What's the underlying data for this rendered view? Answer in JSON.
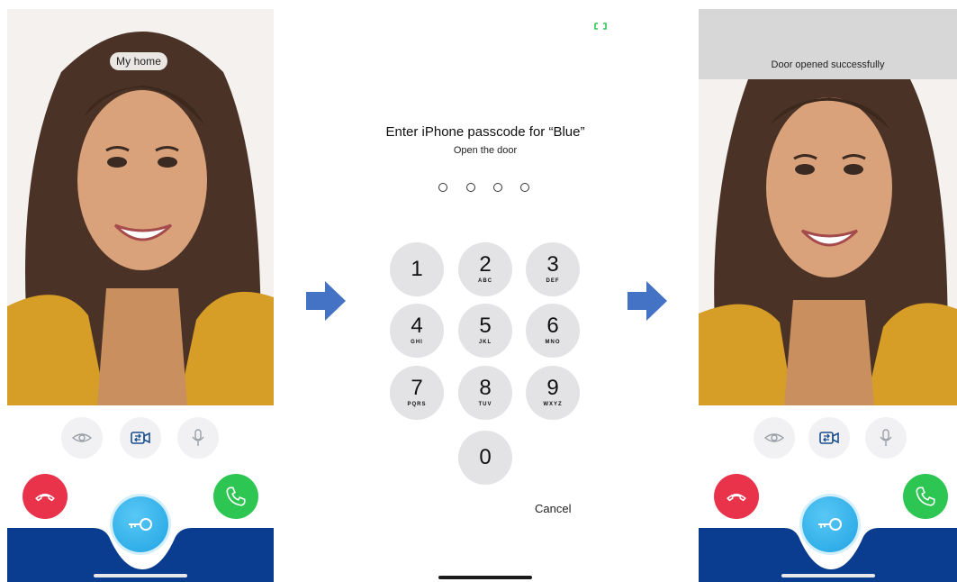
{
  "left_screen": {
    "home_label": "My home",
    "controls": [
      "eye-icon",
      "camera-switch-icon",
      "microphone-icon"
    ],
    "decline_icon": "phone-hangup-icon",
    "accept_icon": "phone-icon",
    "key_icon": "key-icon"
  },
  "passcode_screen": {
    "title": "Enter iPhone passcode for “Blue”",
    "subtitle": "Open the door",
    "passcode_length": 4,
    "keys": [
      {
        "digit": "1",
        "letters": ""
      },
      {
        "digit": "2",
        "letters": "ABC"
      },
      {
        "digit": "3",
        "letters": "DEF"
      },
      {
        "digit": "4",
        "letters": "GHI"
      },
      {
        "digit": "5",
        "letters": "JKL"
      },
      {
        "digit": "6",
        "letters": "MNO"
      },
      {
        "digit": "7",
        "letters": "PQRS"
      },
      {
        "digit": "8",
        "letters": "TUV"
      },
      {
        "digit": "9",
        "letters": "WXYZ"
      },
      {
        "digit": "0",
        "letters": ""
      }
    ],
    "cancel_label": "Cancel"
  },
  "right_screen": {
    "banner": "Door opened successfully",
    "controls": [
      "eye-icon",
      "camera-switch-icon",
      "microphone-icon"
    ],
    "decline_icon": "phone-hangup-icon",
    "accept_icon": "phone-icon",
    "key_icon": "key-icon"
  },
  "arrows": [
    "right-arrow-icon",
    "right-arrow-icon"
  ],
  "colors": {
    "decline": "#e8334a",
    "accept": "#2dc653",
    "key_button": "#21a3e3",
    "bottom_bar": "#0a3d8f",
    "arrow": "#4472c4",
    "keypad_key": "#e3e3e5",
    "banner": "#d7d7d7"
  }
}
